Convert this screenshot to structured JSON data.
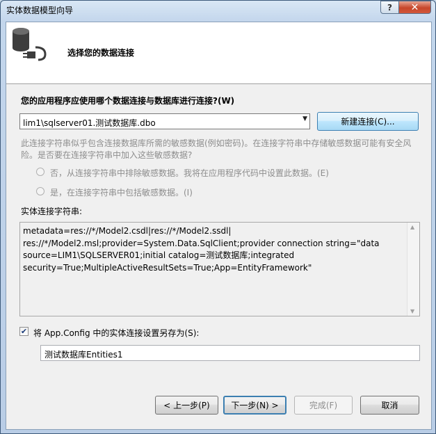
{
  "window": {
    "title": "实体数据模型向导",
    "help_glyph": "?",
    "close_glyph": "✕"
  },
  "header": {
    "title": "选择您的数据连接"
  },
  "connection": {
    "question": "您的应用程序应使用哪个数据连接与数据库进行连接?(W)",
    "selected": "lim1\\sqlserver01.测试数据库.dbo",
    "new_connection_label": "新建连接(C)..."
  },
  "sensitive": {
    "description": "此连接字符串似乎包含连接数据库所需的敏感数据(例如密码)。在连接字符串中存储敏感数据可能有安全风险。是否要在连接字符串中加入这些敏感数据?",
    "option_no": "否，从连接字符串中排除敏感数据。我将在应用程序代码中设置此数据。(E)",
    "option_yes": "是，在连接字符串中包括敏感数据。(I)"
  },
  "entity_connection": {
    "label": "实体连接字符串:",
    "value": "metadata=res://*/Model2.csdl|res://*/Model2.ssdl|\nres://*/Model2.msl;provider=System.Data.SqlClient;provider connection string=\"data\nsource=LIM1\\SQLSERVER01;initial catalog=测试数据库;integrated\nsecurity=True;MultipleActiveResultSets=True;App=EntityFramework\""
  },
  "save_settings": {
    "checked": true,
    "check_glyph": "✔",
    "label": "将 App.Config 中的实体连接设置另存为(S):",
    "name": "测试数据库Entities1"
  },
  "footer": {
    "back_label": "< 上一步(P)",
    "next_label": "下一步(N) >",
    "finish_label": "完成(F)",
    "cancel_label": "取消"
  }
}
